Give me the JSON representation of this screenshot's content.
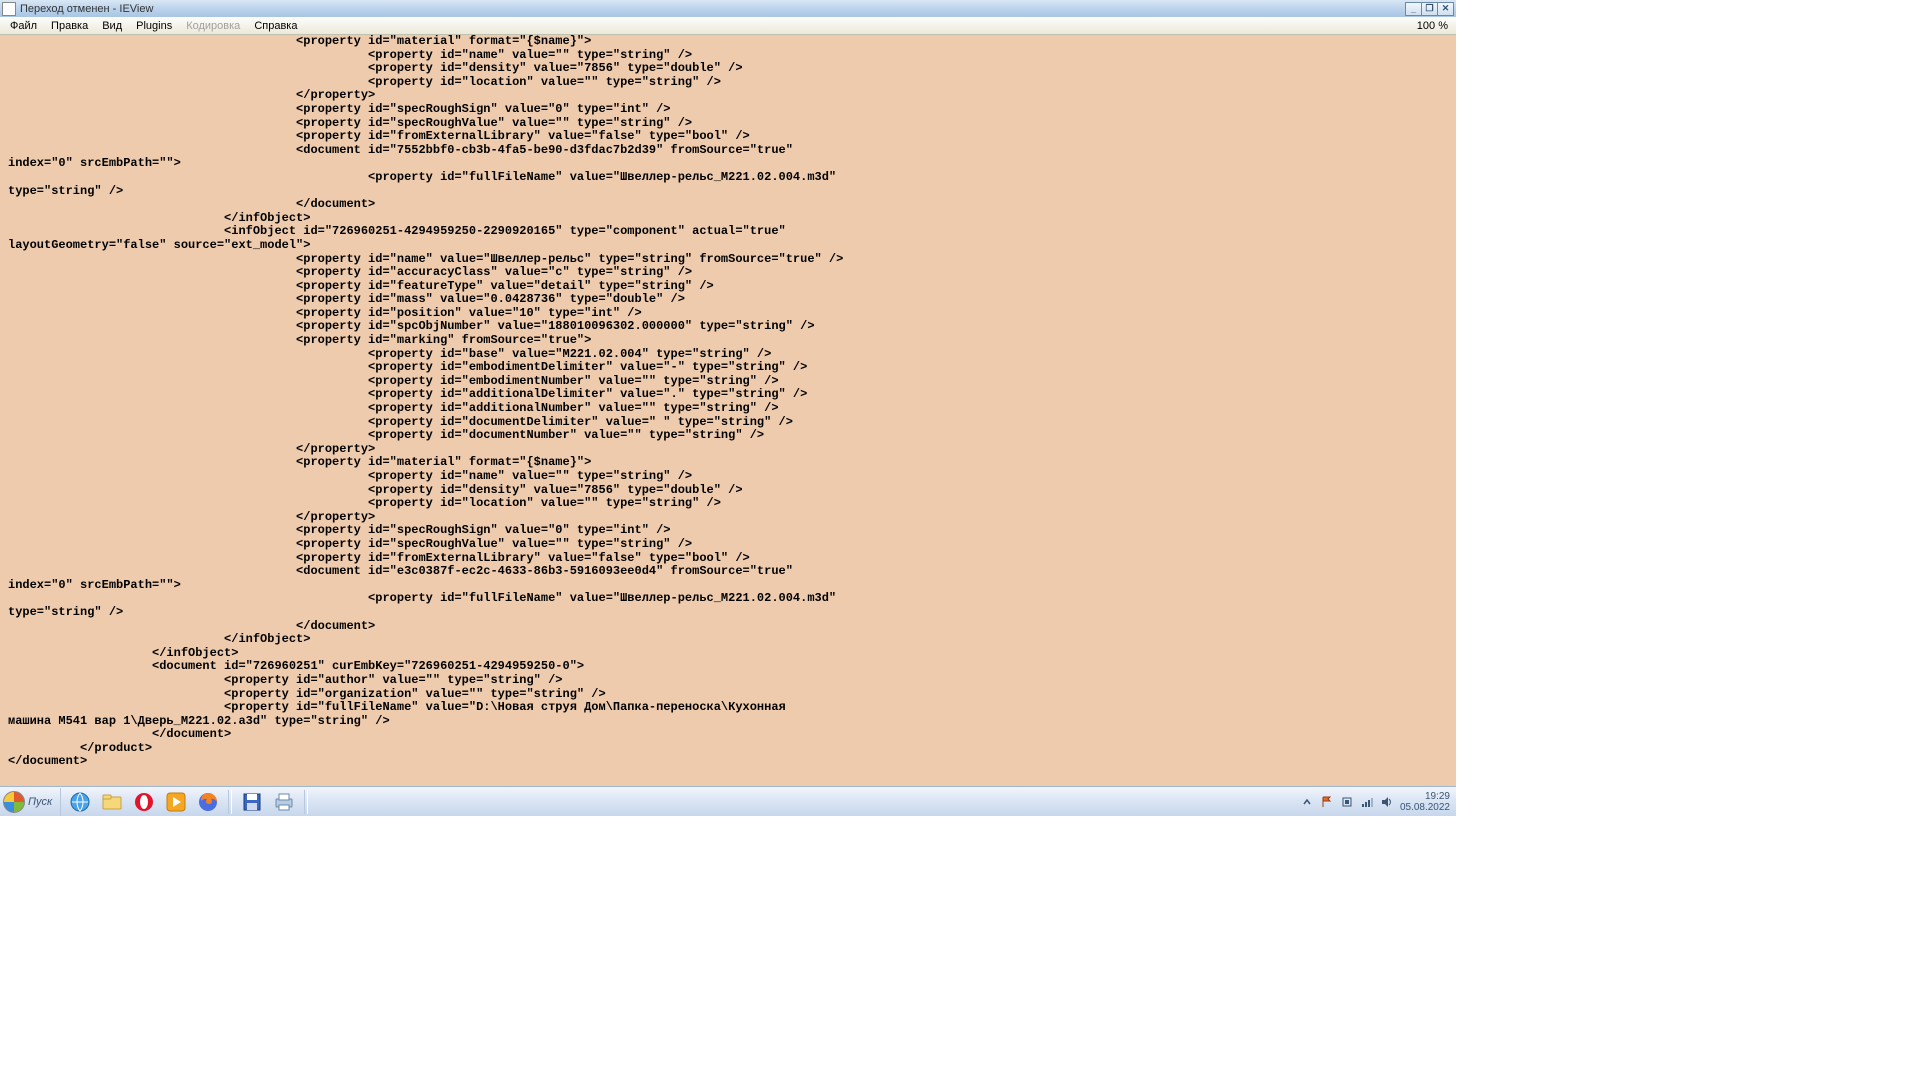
{
  "titlebar": {
    "text": "Переход отменен - IEView"
  },
  "winbtns": {
    "min": "_",
    "max": "❐",
    "close": "✕"
  },
  "menu": {
    "file": "Файл",
    "edit": "Правка",
    "view": "Вид",
    "plugins": "Plugins",
    "encoding": "Кодировка",
    "help": "Справка",
    "zoom": "100 %"
  },
  "content": "                                        <property id=\"material\" format=\"{$name}\">\n                                                  <property id=\"name\" value=\"\" type=\"string\" />\n                                                  <property id=\"density\" value=\"7856\" type=\"double\" />\n                                                  <property id=\"location\" value=\"\" type=\"string\" />\n                                        </property>\n                                        <property id=\"specRoughSign\" value=\"0\" type=\"int\" />\n                                        <property id=\"specRoughValue\" value=\"\" type=\"string\" />\n                                        <property id=\"fromExternalLibrary\" value=\"false\" type=\"bool\" />\n                                        <document id=\"7552bbf0-cb3b-4fa5-be90-d3fdac7b2d39\" fromSource=\"true\"\nindex=\"0\" srcEmbPath=\"\">\n                                                  <property id=\"fullFileName\" value=\"Швеллер-рельс_М221.02.004.m3d\"\ntype=\"string\" />\n                                        </document>\n                              </infObject>\n                              <infObject id=\"726960251-4294959250-2290920165\" type=\"component\" actual=\"true\"\nlayoutGeometry=\"false\" source=\"ext_model\">\n                                        <property id=\"name\" value=\"Швеллер-рельс\" type=\"string\" fromSource=\"true\" />\n                                        <property id=\"accuracyClass\" value=\"c\" type=\"string\" />\n                                        <property id=\"featureType\" value=\"detail\" type=\"string\" />\n                                        <property id=\"mass\" value=\"0.0428736\" type=\"double\" />\n                                        <property id=\"position\" value=\"10\" type=\"int\" />\n                                        <property id=\"spcObjNumber\" value=\"188010096302.000000\" type=\"string\" />\n                                        <property id=\"marking\" fromSource=\"true\">\n                                                  <property id=\"base\" value=\"М221.02.004\" type=\"string\" />\n                                                  <property id=\"embodimentDelimiter\" value=\"-\" type=\"string\" />\n                                                  <property id=\"embodimentNumber\" value=\"\" type=\"string\" />\n                                                  <property id=\"additionalDelimiter\" value=\".\" type=\"string\" />\n                                                  <property id=\"additionalNumber\" value=\"\" type=\"string\" />\n                                                  <property id=\"documentDelimiter\" value=\" \" type=\"string\" />\n                                                  <property id=\"documentNumber\" value=\"\" type=\"string\" />\n                                        </property>\n                                        <property id=\"material\" format=\"{$name}\">\n                                                  <property id=\"name\" value=\"\" type=\"string\" />\n                                                  <property id=\"density\" value=\"7856\" type=\"double\" />\n                                                  <property id=\"location\" value=\"\" type=\"string\" />\n                                        </property>\n                                        <property id=\"specRoughSign\" value=\"0\" type=\"int\" />\n                                        <property id=\"specRoughValue\" value=\"\" type=\"string\" />\n                                        <property id=\"fromExternalLibrary\" value=\"false\" type=\"bool\" />\n                                        <document id=\"e3c0387f-ec2c-4633-86b3-5916093ee0d4\" fromSource=\"true\"\nindex=\"0\" srcEmbPath=\"\">\n                                                  <property id=\"fullFileName\" value=\"Швеллер-рельс_М221.02.004.m3d\"\ntype=\"string\" />\n                                        </document>\n                              </infObject>\n                    </infObject>\n                    <document id=\"726960251\" curEmbKey=\"726960251-4294959250-0\">\n                              <property id=\"author\" value=\"\" type=\"string\" />\n                              <property id=\"organization\" value=\"\" type=\"string\" />\n                              <property id=\"fullFileName\" value=\"D:\\Новая струя Дом\\Папка-переноска\\Кухонная\nмашина М541 вар 1\\Дверь_М221.02.a3d\" type=\"string\" />\n                    </document>\n          </product>\n</document>",
  "start": {
    "label": "Пуск"
  },
  "clock": {
    "time": "19:29",
    "date": "05.08.2022"
  }
}
